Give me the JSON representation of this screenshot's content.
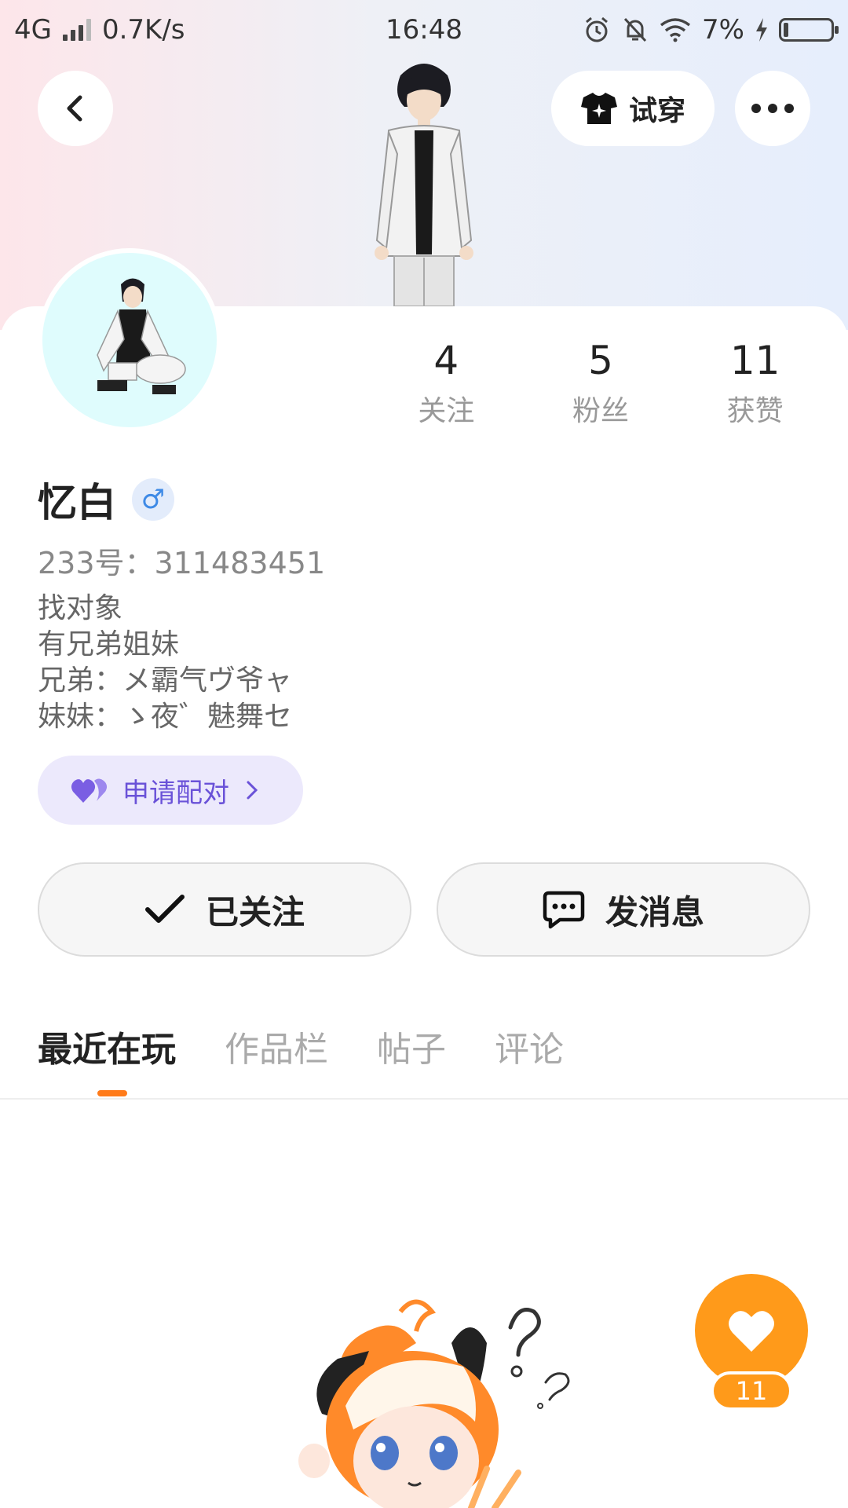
{
  "status_bar": {
    "network": "4G",
    "speed": "0.7K/s",
    "time": "16:48",
    "battery": "7%"
  },
  "header": {
    "try_on_label": "试穿"
  },
  "stats": [
    {
      "value": "4",
      "label": "关注"
    },
    {
      "value": "5",
      "label": "粉丝"
    },
    {
      "value": "11",
      "label": "获赞"
    }
  ],
  "profile": {
    "name": "忆白",
    "gender_symbol": "♂",
    "uid": "233号：311483451",
    "bio_lines": [
      "找对象",
      "有兄弟姐妹",
      "兄弟：メ霸气ヴ爷ャ",
      "妹妹：ゝ夜゛魅舞セ"
    ]
  },
  "pair": {
    "label": "申请配对"
  },
  "actions": {
    "follow_label": "已关注",
    "message_label": "发消息"
  },
  "tabs": [
    {
      "label": "最近在玩",
      "active": true
    },
    {
      "label": "作品栏",
      "active": false
    },
    {
      "label": "帖子",
      "active": false
    },
    {
      "label": "评论",
      "active": false
    }
  ],
  "like": {
    "count": "11"
  },
  "colors": {
    "accent_orange": "#ff9a1a",
    "tab_indicator": "#ff7b1a",
    "pair_purple": "#6a52d8",
    "gender_blue": "#3e8ae6"
  }
}
